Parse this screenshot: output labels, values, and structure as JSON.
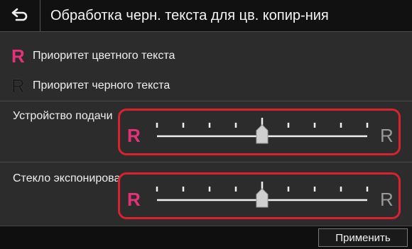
{
  "header": {
    "back_icon": "back-arrow-icon",
    "title": "Обработка черн. текста для цв. копир-ния"
  },
  "legend": {
    "color_label": "Приоритет цветного текста",
    "black_label": "Приоритет черного текста",
    "color_glyph": "R",
    "black_glyph": "R"
  },
  "feeder": {
    "label": "Устройство подачи",
    "left_glyph": "R",
    "right_glyph": "R",
    "steps": 9,
    "value_step": 4
  },
  "glass": {
    "label": "Стекло экспонирования",
    "left_glyph": "R",
    "right_glyph": "R",
    "steps": 9,
    "value_step": 4
  },
  "footer": {
    "apply_label": "Применить"
  },
  "colors": {
    "accent_pink": "#e2337a",
    "highlight_red": "#d8222f"
  }
}
